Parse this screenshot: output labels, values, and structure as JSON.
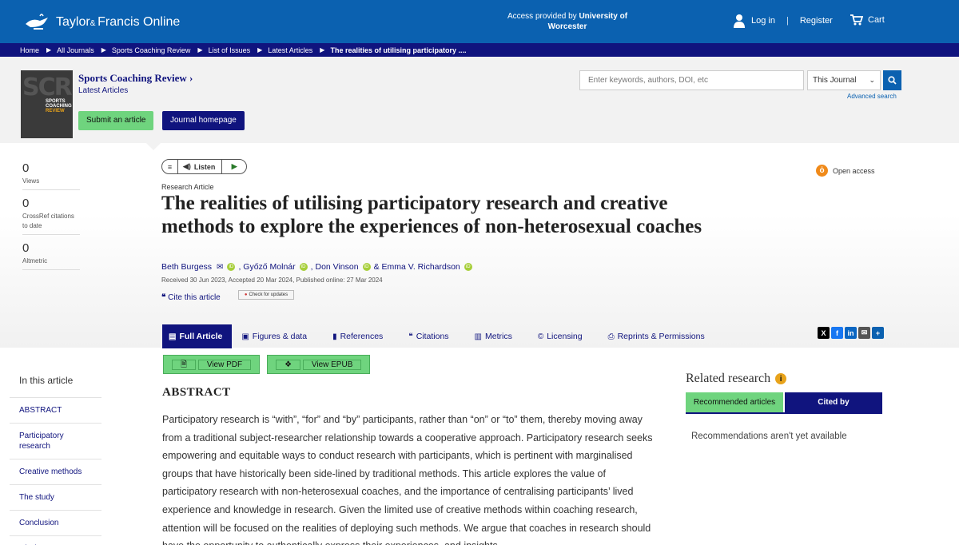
{
  "header": {
    "brand": "Taylor",
    "brand_amp": "& ",
    "brand_rest": "Francis Online",
    "access_prefix": "Access provided by",
    "access_institution": "University of Worcester",
    "login": "Log in",
    "separator": "|",
    "register": "Register",
    "cart": "Cart"
  },
  "breadcrumb": [
    "Home",
    "All Journals",
    "Sports Coaching Review",
    "List of Issues",
    "Latest Articles",
    "The realities of utilising participatory ...."
  ],
  "journal": {
    "cover_letters": "SCR",
    "cover_title_1": "SPORTS",
    "cover_title_2": "COACHING",
    "cover_title_3": "REVIEW",
    "title": "Sports Coaching Review",
    "title_chevron": "›",
    "subtitle": "Latest Articles",
    "submit_label": "Submit an article",
    "homepage_label": "Journal homepage"
  },
  "search": {
    "placeholder": "Enter keywords, authors, DOI, etc",
    "scope_selected": "This Journal",
    "advanced": "Advanced search"
  },
  "metrics": [
    {
      "value": "0",
      "label": "Views"
    },
    {
      "value": "0",
      "label": "CrossRef citations to date"
    },
    {
      "value": "0",
      "label": "Altmetric"
    }
  ],
  "listen": {
    "label": "Listen"
  },
  "open_access": "Open access",
  "article": {
    "type": "Research Article",
    "title": "The realities of utilising participatory research and creative methods to explore the experiences of non-heterosexual coaches",
    "authors": [
      {
        "name": "Beth Burgess",
        "suffix": ","
      },
      {
        "name": "Győző Molnár",
        "suffix": ","
      },
      {
        "name": "Don Vinson",
        "suffix": " &"
      },
      {
        "name": "Emma V. Richardson",
        "suffix": ""
      }
    ],
    "dates": "Received 30 Jun 2023, Accepted 20 Mar 2024, Published online: 27 Mar 2024",
    "cite": "Cite this article",
    "check_updates": "Check for updates"
  },
  "tabs": [
    {
      "icon": "▤",
      "label": "Full Article"
    },
    {
      "icon": "▣",
      "label": "Figures & data"
    },
    {
      "icon": "▮",
      "label": "References"
    },
    {
      "icon": "❝",
      "label": "Citations"
    },
    {
      "icon": "▥",
      "label": "Metrics"
    },
    {
      "icon": "©",
      "label": "Licensing"
    },
    {
      "icon": "⎙",
      "label": "Reprints & Permissions"
    }
  ],
  "share_colors": {
    "x": "#000000",
    "facebook": "#1877f2",
    "linkedin": "#0a66c2",
    "email": "#555555",
    "more": "#0b61b0"
  },
  "actions": {
    "pdf": "View PDF",
    "epub": "View EPUB"
  },
  "toc": {
    "title": "In this article",
    "items": [
      "ABSTRACT",
      "Participatory research",
      "Creative methods",
      "The study",
      "Conclusion",
      "Disclosure"
    ]
  },
  "abstract": {
    "heading": "ABSTRACT",
    "text": "Participatory research is “with”, “for” and “by” participants, rather than “on” or “to” them, thereby moving away from a traditional subject-researcher relationship towards a cooperative approach. Participatory research seeks empowering and equitable ways to conduct research with participants, which is pertinent with marginalised groups that have historically been side-lined by traditional methods. This article explores the value of participatory research with non-heterosexual coaches, and the importance of centralising participants’ lived experience and knowledge in research. Given the limited use of creative methods within coaching research, attention will be focused on the realities of deploying such methods. We argue that coaches in research should have the opportunity to authentically express their experiences, and insights"
  },
  "related": {
    "heading": "Related research",
    "tab_recommended": "Recommended articles",
    "tab_cited": "Cited by",
    "empty": "Recommendations aren't yet available"
  }
}
